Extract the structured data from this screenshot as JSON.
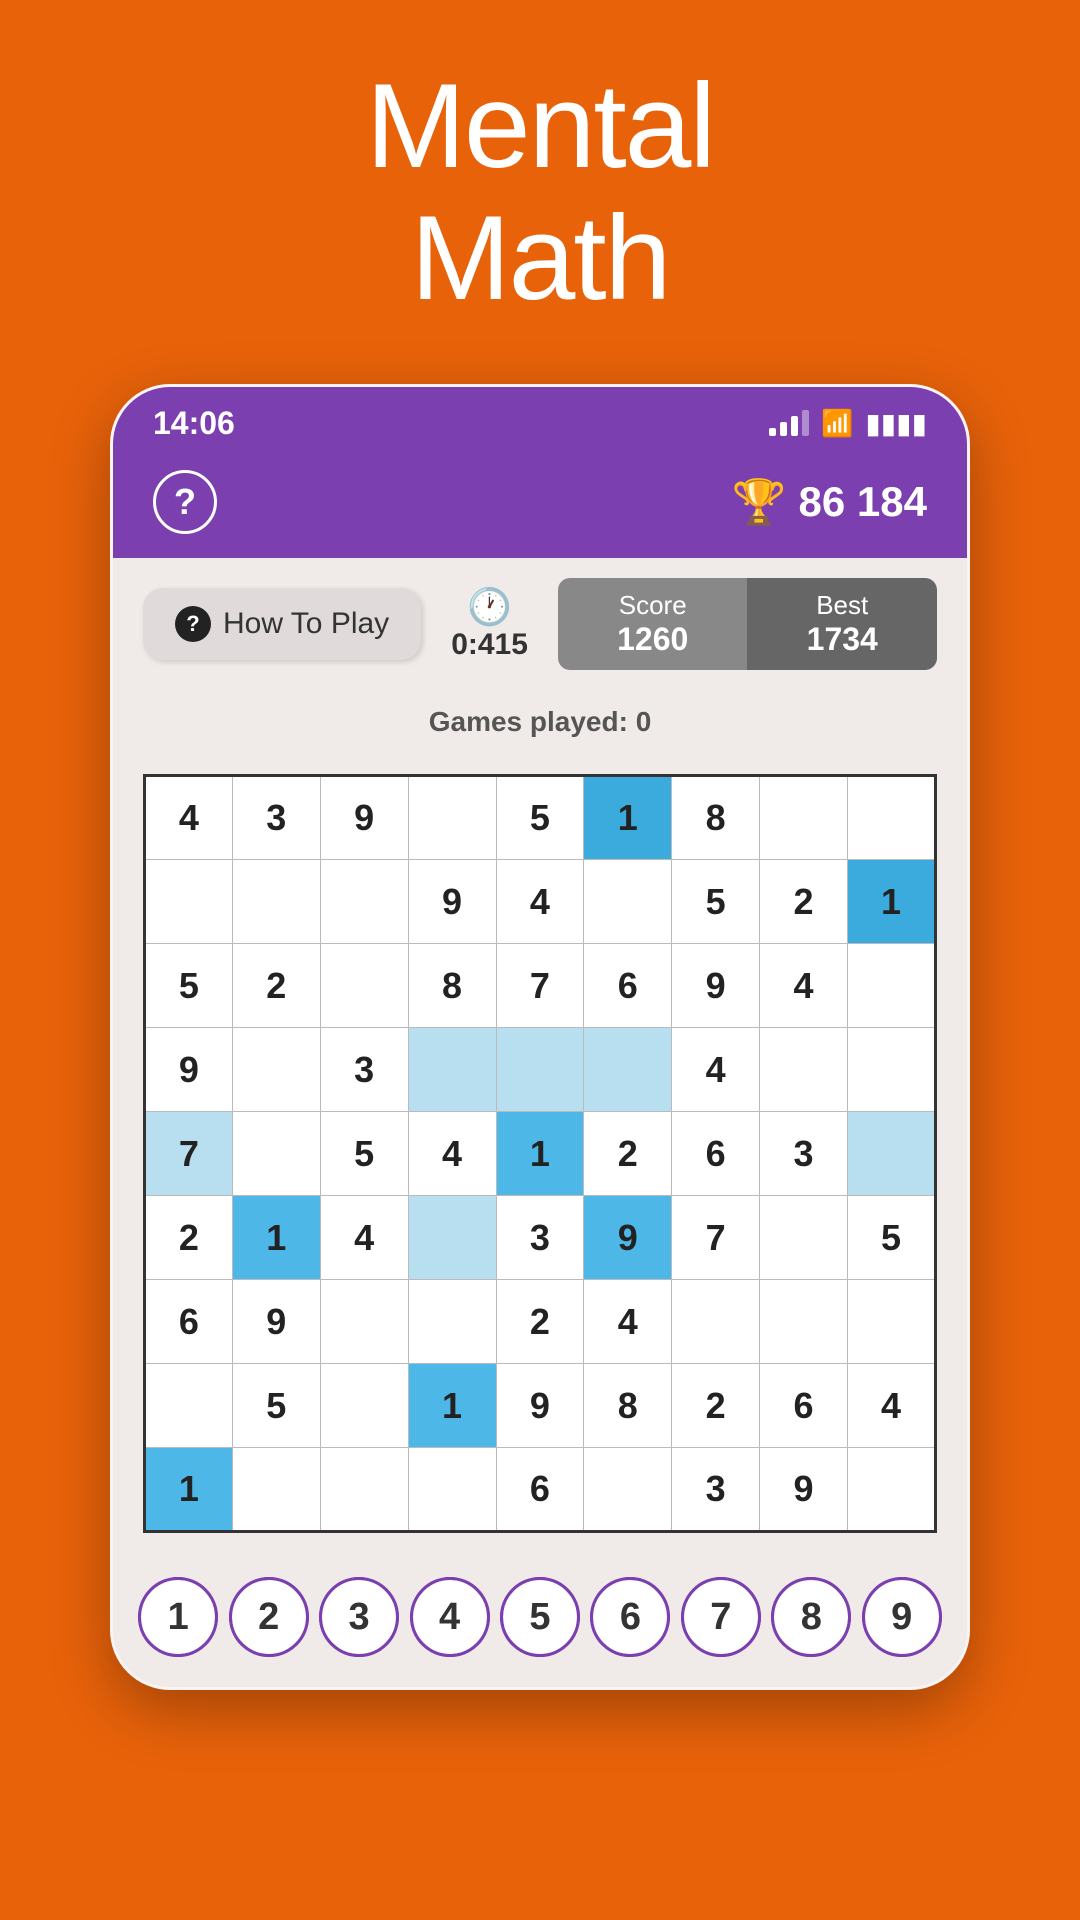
{
  "app": {
    "title_line1": "Mental",
    "title_line2": "Math"
  },
  "status_bar": {
    "time": "14:06",
    "signal": "signal-icon",
    "wifi": "wifi-icon",
    "battery": "battery-icon"
  },
  "header": {
    "help_label": "?",
    "trophy_icon": "trophy-icon",
    "score_display": "86 184"
  },
  "controls": {
    "how_to_play_label": "How To Play",
    "timer_label": "0:415",
    "score_label": "Score",
    "score_value": "1260",
    "best_label": "Best",
    "best_value": "1734"
  },
  "games_played": {
    "label": "Games played: 0"
  },
  "grid": {
    "rows": [
      [
        "4",
        "3",
        "9",
        "",
        "5",
        "1",
        "8",
        "",
        ""
      ],
      [
        "",
        "",
        "",
        "9",
        "4",
        "",
        "5",
        "2",
        "1"
      ],
      [
        "5",
        "2",
        "",
        "8",
        "7",
        "6",
        "9",
        "4",
        ""
      ],
      [
        "9",
        "",
        "3",
        "",
        "",
        "",
        "4",
        "",
        ""
      ],
      [
        "7",
        "",
        "5",
        "4",
        "1",
        "2",
        "6",
        "3",
        ""
      ],
      [
        "2",
        "1",
        "4",
        "",
        "3",
        "9",
        "7",
        "",
        "5"
      ],
      [
        "6",
        "9",
        "",
        "",
        "2",
        "4",
        "",
        "",
        ""
      ],
      [
        "",
        "5",
        "",
        "1",
        "9",
        "8",
        "2",
        "6",
        "4"
      ],
      [
        "1",
        "",
        "",
        "",
        "6",
        "",
        "3",
        "9",
        ""
      ]
    ],
    "cell_styles": [
      [
        "white",
        "white",
        "white",
        "white",
        "white",
        "dark-blue",
        "white",
        "white",
        "white"
      ],
      [
        "white",
        "white",
        "white",
        "white",
        "white",
        "white",
        "white",
        "white",
        "dark-blue"
      ],
      [
        "white",
        "white",
        "white",
        "white",
        "white",
        "white",
        "white",
        "white",
        "white"
      ],
      [
        "white",
        "white",
        "white",
        "light-blue",
        "light-blue",
        "light-blue",
        "white",
        "white",
        "white"
      ],
      [
        "light-blue",
        "white",
        "white",
        "white",
        "blue",
        "white",
        "white",
        "white",
        "light-blue"
      ],
      [
        "white",
        "blue",
        "white",
        "light-blue",
        "white",
        "blue",
        "white",
        "white",
        "white"
      ],
      [
        "white",
        "white",
        "white",
        "white",
        "white",
        "white",
        "white",
        "white",
        "white"
      ],
      [
        "white",
        "white",
        "white",
        "blue",
        "white",
        "white",
        "white",
        "white",
        "white"
      ],
      [
        "blue",
        "white",
        "white",
        "white",
        "white",
        "white",
        "white",
        "white",
        "white"
      ]
    ]
  },
  "number_picker": {
    "numbers": [
      "1",
      "2",
      "3",
      "4",
      "5",
      "6",
      "7",
      "8",
      "9"
    ]
  }
}
